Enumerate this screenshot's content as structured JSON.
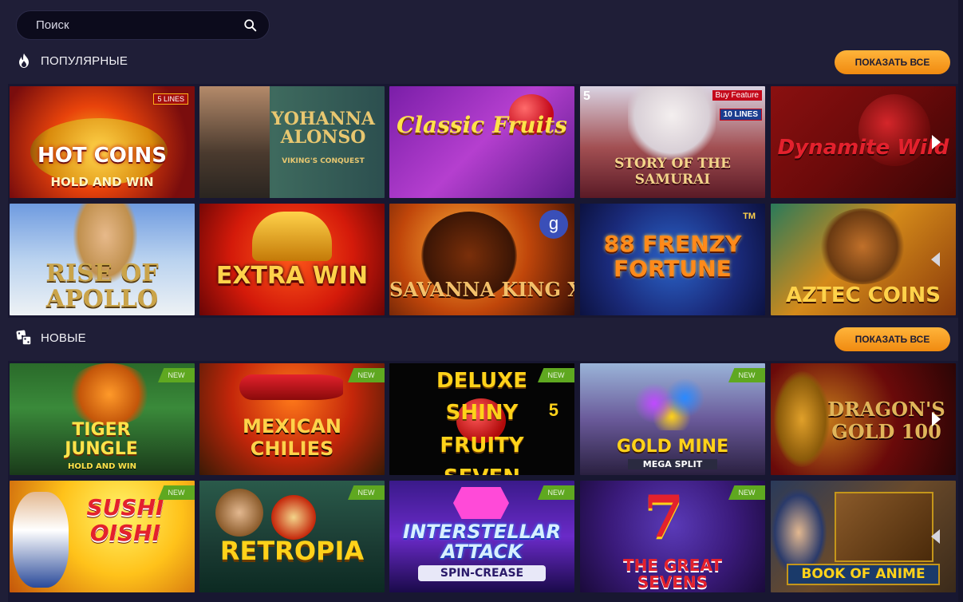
{
  "search": {
    "placeholder": "Поиск",
    "icon": "search-icon"
  },
  "sections": [
    {
      "title": "ПОПУЛЯРНЫЕ",
      "icon": "fire-icon",
      "show_all_label": "ПОКАЗАТЬ ВСЕ"
    },
    {
      "title": "НОВЫЕ",
      "icon": "dice-icon",
      "show_all_label": "ПОКАЗАТЬ ВСЕ"
    }
  ],
  "popular_games": [
    {
      "title": "HOT COINS",
      "subtitle": "HOLD AND WIN",
      "tag": "5 LINES"
    },
    {
      "title": "YOHANNA ALONSO",
      "subtitle": "VIKING'S CONQUEST"
    },
    {
      "title": "Classic Fruits"
    },
    {
      "title": "STORY OF THE SAMURAI",
      "tag": "Buy Feature",
      "tag2": "10 LINES",
      "corner": "5"
    },
    {
      "title": "Dynamite Wild"
    },
    {
      "title": "RISE OF APOLLO"
    },
    {
      "title": "EXTRA WIN"
    },
    {
      "title": "SAVANNA KING XL",
      "corner": "g"
    },
    {
      "title": "88 FRENZY FORTUNE",
      "tm": "TM"
    },
    {
      "title": "AZTEC COINS"
    }
  ],
  "new_games": [
    {
      "title": "TIGER JUNGLE",
      "subtitle": "HOLD AND WIN",
      "badge": "NEW"
    },
    {
      "title": "MEXICAN CHILIES",
      "badge": "NEW"
    },
    {
      "title": "DELUXE SHINY FRUITY SEVEN",
      "tag": "5",
      "badge": "NEW"
    },
    {
      "title": "GOLD MINE",
      "subtitle": "MEGA SPLIT",
      "badge": "NEW"
    },
    {
      "title": "DRAGON'S GOLD 100"
    },
    {
      "title": "SUSHI OISHI",
      "badge": "NEW"
    },
    {
      "title": "RETROPIA",
      "badge": "NEW"
    },
    {
      "title": "INTERSTELLAR ATTACK",
      "subtitle": "SPIN-CREASE",
      "badge": "NEW"
    },
    {
      "title": "THE GREAT SEVENS",
      "badge": "NEW"
    },
    {
      "title": "BOOK OF ANIME"
    }
  ],
  "colors": {
    "background": "#1f1e37",
    "accent": "#f7a325",
    "badge": "#5fa820"
  }
}
